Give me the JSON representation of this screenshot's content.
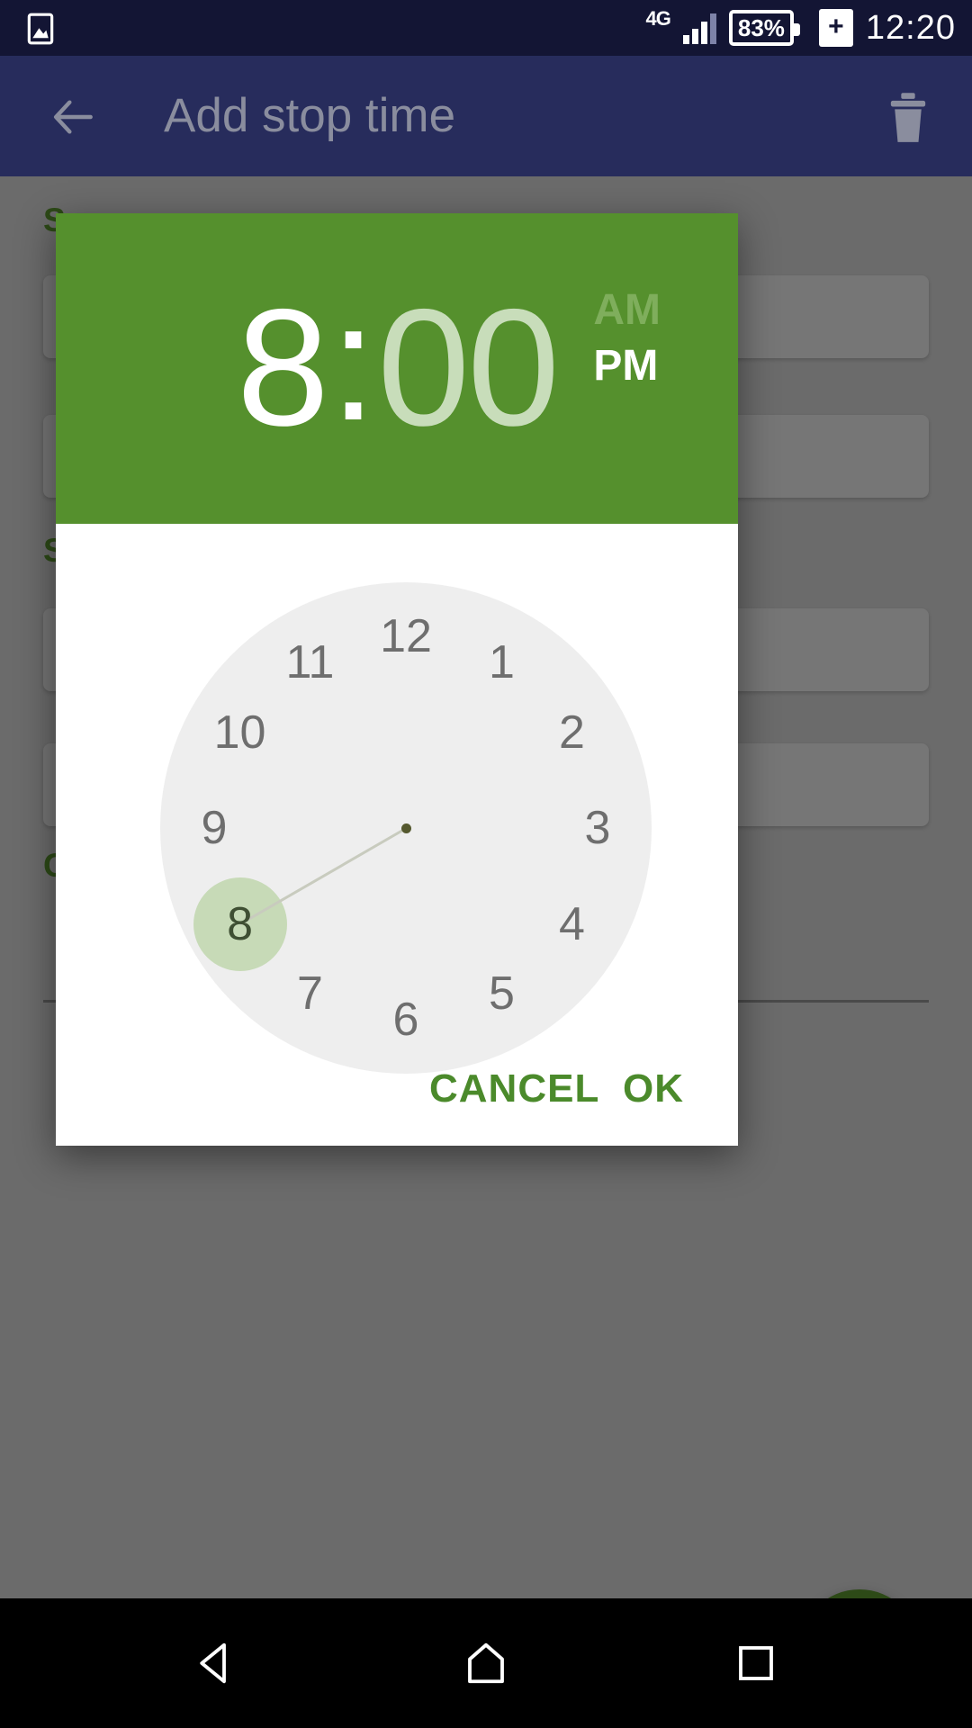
{
  "status_bar": {
    "photo_icon": "image-icon",
    "network": "4G",
    "signal_icon": "signal-bars-icon",
    "battery_percent": "83%",
    "battery_charging_icon": "plus-icon",
    "clock": "12:20"
  },
  "app_bar": {
    "back_icon": "back-arrow-icon",
    "title": "Add stop time",
    "delete_icon": "trash-icon",
    "background_color": "#272c5c"
  },
  "background": {
    "section_labels": [
      "S",
      "S",
      "C"
    ],
    "fab_icon": "save-icon",
    "fab_color": "#2d4a17"
  },
  "dialog": {
    "header": {
      "hour": "8",
      "colon": ":",
      "minute": "00",
      "am_label": "AM",
      "pm_label": "PM",
      "selected_period": "PM",
      "selected_unit": "hour",
      "background_color": "#55902d"
    },
    "clock": {
      "numbers": [
        "12",
        "1",
        "2",
        "3",
        "4",
        "5",
        "6",
        "7",
        "8",
        "9",
        "10",
        "11"
      ],
      "selected_number": "8",
      "selected_index": 8,
      "face_color": "#eeeeee",
      "selection_color": "#c7dab7"
    },
    "actions": {
      "cancel_label": "CANCEL",
      "ok_label": "OK",
      "accent_color": "#4b8a2b"
    }
  },
  "nav_bar": {
    "back_icon": "nav-back-triangle-icon",
    "home_icon": "nav-home-icon",
    "recents_icon": "nav-recents-square-icon"
  }
}
